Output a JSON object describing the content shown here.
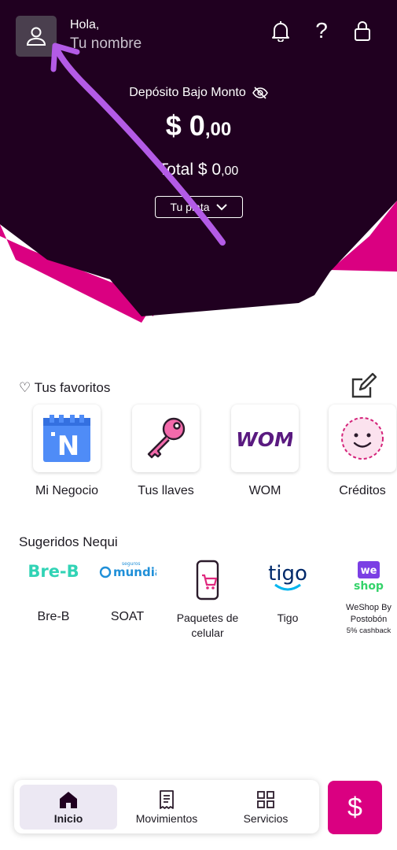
{
  "colors": {
    "header_bg": "#200020",
    "accent_pink": "#da0081",
    "annotation_purple": "#b35be6",
    "active_nav_bg": "#ece8f3"
  },
  "header": {
    "greeting": "Hola,",
    "user_name": "Tu nombre",
    "icons": [
      "user-icon",
      "bell-icon",
      "help-icon",
      "lock-icon"
    ],
    "help_glyph": "?"
  },
  "balance": {
    "account_label": "Depósito Bajo Monto",
    "amount_main": "$ 0",
    "amount_cents": ",00",
    "total_label": "Total $ 0",
    "total_cents": ",00",
    "dropdown_label": "Tu plata"
  },
  "favorites": {
    "title": "♡ Tus favoritos",
    "items": [
      {
        "label": "Mi Negocio",
        "icon": "store-icon"
      },
      {
        "label": "Tus llaves",
        "icon": "key-icon"
      },
      {
        "label": "WOM",
        "icon": "wom-logo",
        "logo_text": "WOM"
      },
      {
        "label": "Créditos",
        "icon": "smiley-icon"
      }
    ]
  },
  "suggested": {
    "title": "Sugeridos Nequi",
    "items": [
      {
        "label": "Bre-B",
        "logo_text": "Bre-B"
      },
      {
        "label": "SOAT",
        "logo_text": "mundial",
        "logo_subtext": "seguros"
      },
      {
        "label": "Paquetes de celular",
        "icon": "phone-cart-icon"
      },
      {
        "label": "Tigo",
        "logo_text": "tigo"
      },
      {
        "label_line1": "WeShop By",
        "label_line2": "Postobón",
        "label_line3": "5% cashback",
        "logo_text": "we",
        "logo_subtext": "shop"
      }
    ]
  },
  "bottom_nav": {
    "items": [
      {
        "label": "Inicio",
        "icon": "home-icon",
        "active": true
      },
      {
        "label": "Movimientos",
        "icon": "receipt-icon",
        "active": false
      },
      {
        "label": "Servicios",
        "icon": "grid-icon",
        "active": false
      }
    ],
    "pay_glyph": "$"
  }
}
